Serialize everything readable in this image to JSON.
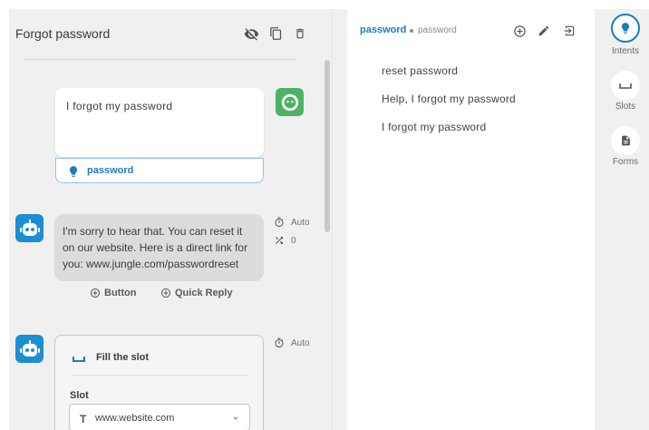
{
  "story": {
    "title": "Forgot password",
    "user_message": "I forgot my password",
    "user_intent": "password",
    "bot_message": "I'm sorry to hear that. You can reset it on our website. Here is a direct link for you: www.jungle.com/passwordreset",
    "bot_delay_label": "Auto",
    "bot_random_count": "0",
    "add_button_label": "Button",
    "add_quick_reply_label": "Quick Reply",
    "slot_delay_label": "Auto",
    "slot_card": {
      "title": "Fill the slot",
      "field_label": "Slot",
      "field_type_glyph": "T",
      "field_value": "www.website.com"
    }
  },
  "intent_panel": {
    "name": "password",
    "subtitle": "password",
    "utterances": [
      "reset password",
      "Help, I forgot my password",
      "I forgot my password"
    ]
  },
  "rail": {
    "items": [
      {
        "label": "Intents",
        "icon": "lightbulb-icon",
        "active": true
      },
      {
        "label": "Slots",
        "icon": "slot-icon",
        "active": false
      },
      {
        "label": "Forms",
        "icon": "document-icon",
        "active": false
      }
    ]
  },
  "colors": {
    "accent": "#1a7dbf",
    "user_avatar": "#4db364",
    "bot_avatar": "#1b8fd2",
    "panel_bg": "#f0f0f0"
  }
}
